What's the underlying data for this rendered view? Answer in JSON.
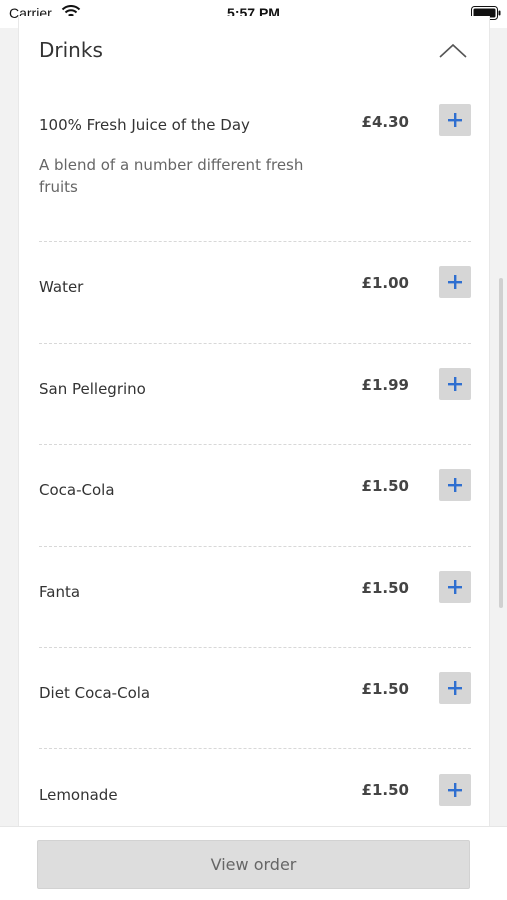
{
  "status_bar": {
    "carrier": "Carrier",
    "time": "5:57 PM"
  },
  "section": {
    "title": "Drinks",
    "collapse_icon": "chevron-up-icon"
  },
  "items": [
    {
      "name": "100% Fresh Juice of the Day",
      "description": "A blend of a number different fresh fruits",
      "price": "£4.30"
    },
    {
      "name": "Water",
      "price": "£1.00"
    },
    {
      "name": "San Pellegrino",
      "price": "£1.99"
    },
    {
      "name": "Coca-Cola",
      "price": "£1.50"
    },
    {
      "name": "Fanta",
      "price": "£1.50"
    },
    {
      "name": "Diet Coca-Cola",
      "price": "£1.50"
    },
    {
      "name": "Lemonade",
      "price": "£1.50"
    }
  ],
  "add_icon": "plus-icon",
  "accent_color": "#2f6fd0",
  "bottom_bar": {
    "view_order_label": "View order"
  }
}
